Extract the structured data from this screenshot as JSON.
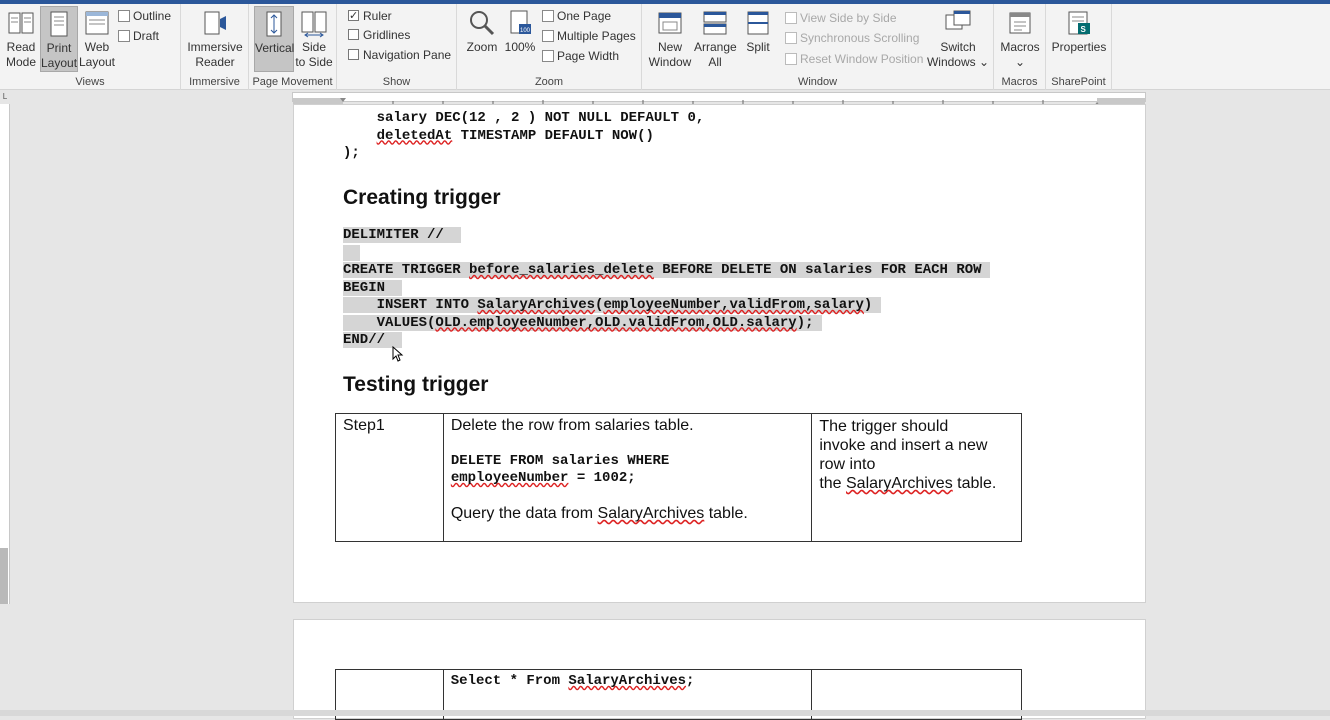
{
  "ribbon": {
    "views": {
      "label": "Views",
      "read_mode": "Read\nMode",
      "print_layout": "Print\nLayout",
      "web_layout": "Web\nLayout",
      "outline": "Outline",
      "draft": "Draft"
    },
    "immersive": {
      "label": "Immersive",
      "reader": "Immersive\nReader"
    },
    "page_movement": {
      "label": "Page Movement",
      "vertical": "Vertical",
      "side_to_side": "Side\nto Side"
    },
    "show": {
      "label": "Show",
      "ruler": "Ruler",
      "gridlines": "Gridlines",
      "navigation_pane": "Navigation Pane",
      "ruler_checked": true,
      "gridlines_checked": false,
      "navigation_pane_checked": false
    },
    "zoom": {
      "label": "Zoom",
      "zoom": "Zoom",
      "percent": "100%",
      "one_page": "One Page",
      "multiple_pages": "Multiple Pages",
      "page_width": "Page Width"
    },
    "window": {
      "label": "Window",
      "new_window": "New\nWindow",
      "arrange_all": "Arrange\nAll",
      "split": "Split",
      "view_side_by_side": "View Side by Side",
      "sync_scrolling": "Synchronous Scrolling",
      "reset_window": "Reset Window Position",
      "switch_windows": "Switch\nWindows ⌄"
    },
    "macros": {
      "label": "Macros",
      "macros": "Macros",
      "chevron": "⌄"
    },
    "sharepoint": {
      "label": "SharePoint",
      "properties": "Properties"
    }
  },
  "document": {
    "code_top": {
      "line_salary_pre": "    salary DEC(12 , 2 ) NOT NULL DEFAULT 0,",
      "line_deleted_word": "deletedAt",
      "line_deleted_rest": " TIMESTAMP DEFAULT NOW()",
      "line_close": ");"
    },
    "heading_creating": "Creating trigger",
    "trigger_code": {
      "l1": "DELIMITER //",
      "l3_a": "CREATE TRIGGER ",
      "l3_b": "before_salaries_delete",
      "l3_c": " BEFORE DELETE ON salaries FOR EACH ROW",
      "l4": "BEGIN",
      "l5_a": "    INSERT INTO ",
      "l5_b": "SalaryArchives",
      "l5_c": "(",
      "l5_d": "employeeNumber,validFrom,salary",
      "l5_e": ")",
      "l6_a": "    VALUES(",
      "l6_b": "OLD.employeeNumber,OLD.validFrom,OLD.salary",
      "l6_c": ");",
      "l7": "END//"
    },
    "heading_testing": "Testing trigger",
    "table": {
      "step": "Step1",
      "desc1": "Delete the row from salaries table.",
      "sql1": "DELETE FROM salaries WHERE",
      "sql2_word": "employeeNumber",
      "sql2_rest": " = 1002;",
      "desc2_pre": "Query the data from ",
      "desc2_word": "SalaryArchives",
      "desc2_post": " table.",
      "expect1": "The trigger should",
      "expect2": "invoke and insert a new",
      "expect3": "row into",
      "expect4_pre": "the ",
      "expect4_word": "SalaryArchives",
      "expect4_post": " table."
    },
    "page2": {
      "select_pre": "Select * From ",
      "select_word": "SalaryArchives",
      "select_post": ";"
    }
  }
}
